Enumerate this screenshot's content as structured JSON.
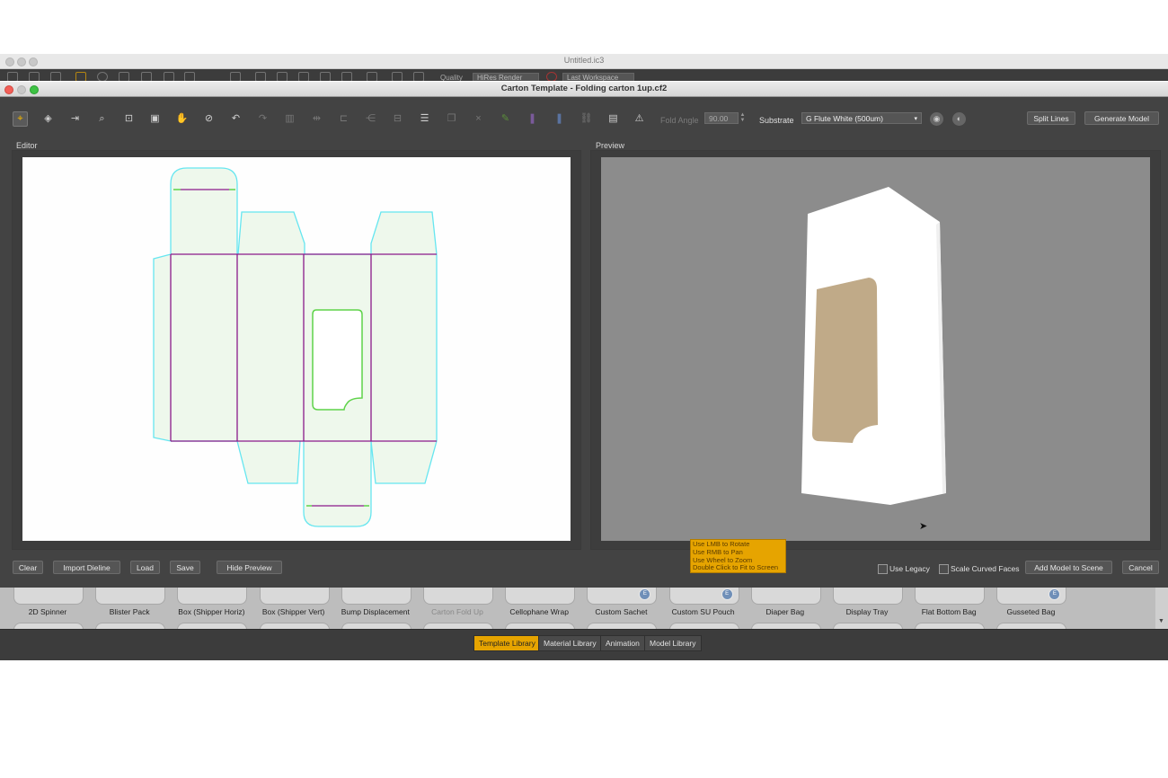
{
  "app": {
    "title": "Untitled.ic3",
    "toolbar": {
      "quality_label": "Quality",
      "quality_value": "HiRes Render",
      "workspace_value": "Last Workspace"
    }
  },
  "dialog": {
    "title": "Carton Template - Folding carton 1up.cf2",
    "toolbar": {
      "fold_angle_label": "Fold Angle",
      "fold_angle_value": "90.00",
      "substrate_label": "Substrate",
      "substrate_value": "G Flute White (500um)",
      "split_lines_label": "Split Lines",
      "generate_model_label": "Generate Model"
    },
    "editor_label": "Editor",
    "preview_label": "Preview",
    "tooltip": [
      "Use LMB to Rotate",
      "Use RMB to Pan",
      "Use Wheel to Zoom",
      "Double Click to Fit to Screen"
    ],
    "footer": {
      "clear_label": "Clear",
      "import_dieline_label": "Import Dieline",
      "load_label": "Load",
      "save_label": "Save",
      "hide_preview_label": "Hide Preview",
      "use_legacy_label": "Use Legacy",
      "use_legacy_checked": false,
      "scale_curved_faces_label": "Scale Curved Faces",
      "scale_curved_faces_checked": false,
      "add_model_label": "Add Model to Scene",
      "cancel_label": "Cancel"
    }
  },
  "library": {
    "items": [
      {
        "label": "2D Spinner",
        "badge": false,
        "dim": false
      },
      {
        "label": "Blister Pack",
        "badge": false,
        "dim": false
      },
      {
        "label": "Box (Shipper Horiz)",
        "badge": false,
        "dim": false
      },
      {
        "label": "Box (Shipper Vert)",
        "badge": false,
        "dim": false
      },
      {
        "label": "Bump Displacement",
        "badge": false,
        "dim": false
      },
      {
        "label": "Carton Fold Up",
        "badge": false,
        "dim": true
      },
      {
        "label": "Cellophane Wrap",
        "badge": false,
        "dim": false
      },
      {
        "label": "Custom Sachet",
        "badge": true,
        "dim": false
      },
      {
        "label": "Custom SU Pouch",
        "badge": true,
        "dim": false
      },
      {
        "label": "Diaper Bag",
        "badge": false,
        "dim": false
      },
      {
        "label": "Display Tray",
        "badge": false,
        "dim": false
      },
      {
        "label": "Flat Bottom Bag",
        "badge": false,
        "dim": false
      },
      {
        "label": "Gusseted Bag",
        "badge": true,
        "dim": false
      }
    ]
  },
  "bottom_tabs": [
    {
      "label": "Template Library",
      "active": true
    },
    {
      "label": "Material Library",
      "active": false
    },
    {
      "label": "Animation",
      "active": false
    },
    {
      "label": "Model Library",
      "active": false
    }
  ],
  "colors": {
    "accent": "#e6a400",
    "dieline_cut": "#66e6f0",
    "dieline_fold": "#8a1a8a",
    "window_green": "#5fd34a",
    "panel_fill": "#eef8ec",
    "preview_bg": "#8c8c8c",
    "window_film": "#c0aa88"
  }
}
